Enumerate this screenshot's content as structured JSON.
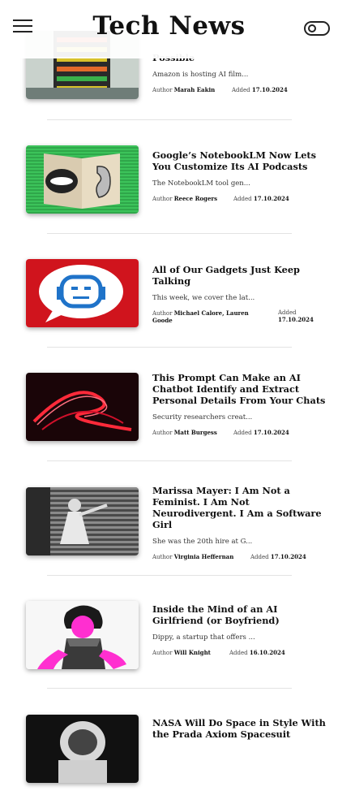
{
  "header": {
    "title": "Tech News",
    "menu_icon": "hamburger-icon",
    "toggle_icon": "theme-toggle-icon"
  },
  "labels": {
    "author": "Author",
    "added": "Added"
  },
  "articles": [
    {
      "title": "Possible",
      "excerpt": "Amazon is hosting AI film...",
      "author": "Marah Eakin",
      "date": "17.10.2024"
    },
    {
      "title": "Google’s NotebookLM Now Lets You Customize Its AI Podcasts",
      "excerpt": "The NotebookLM tool gen...",
      "author": "Reece Rogers",
      "date": "17.10.2024"
    },
    {
      "title": "All of Our Gadgets Just Keep Talking",
      "excerpt": "This week, we cover the lat...",
      "author": "Michael Calore, Lauren Goode",
      "date": "17.10.2024"
    },
    {
      "title": "This Prompt Can Make an AI Chatbot Identify and Extract Personal Details From Your Chats",
      "excerpt": "Security researchers creat...",
      "author": "Matt Burgess",
      "date": "17.10.2024"
    },
    {
      "title": "Marissa Mayer: I Am Not a Feminist. I Am Not Neurodivergent. I Am a Software Girl",
      "excerpt": "She was the 20th hire at G...",
      "author": "Virginia Heffernan",
      "date": "17.10.2024"
    },
    {
      "title": "Inside the Mind of an AI Girlfriend (or Boyfriend)",
      "excerpt": "Dippy, a startup that offers ...",
      "author": "Will Knight",
      "date": "16.10.2024"
    },
    {
      "title": "NASA Will Do Space in Style With the Prada Axiom Spacesuit",
      "excerpt": "",
      "author": "",
      "date": ""
    }
  ]
}
